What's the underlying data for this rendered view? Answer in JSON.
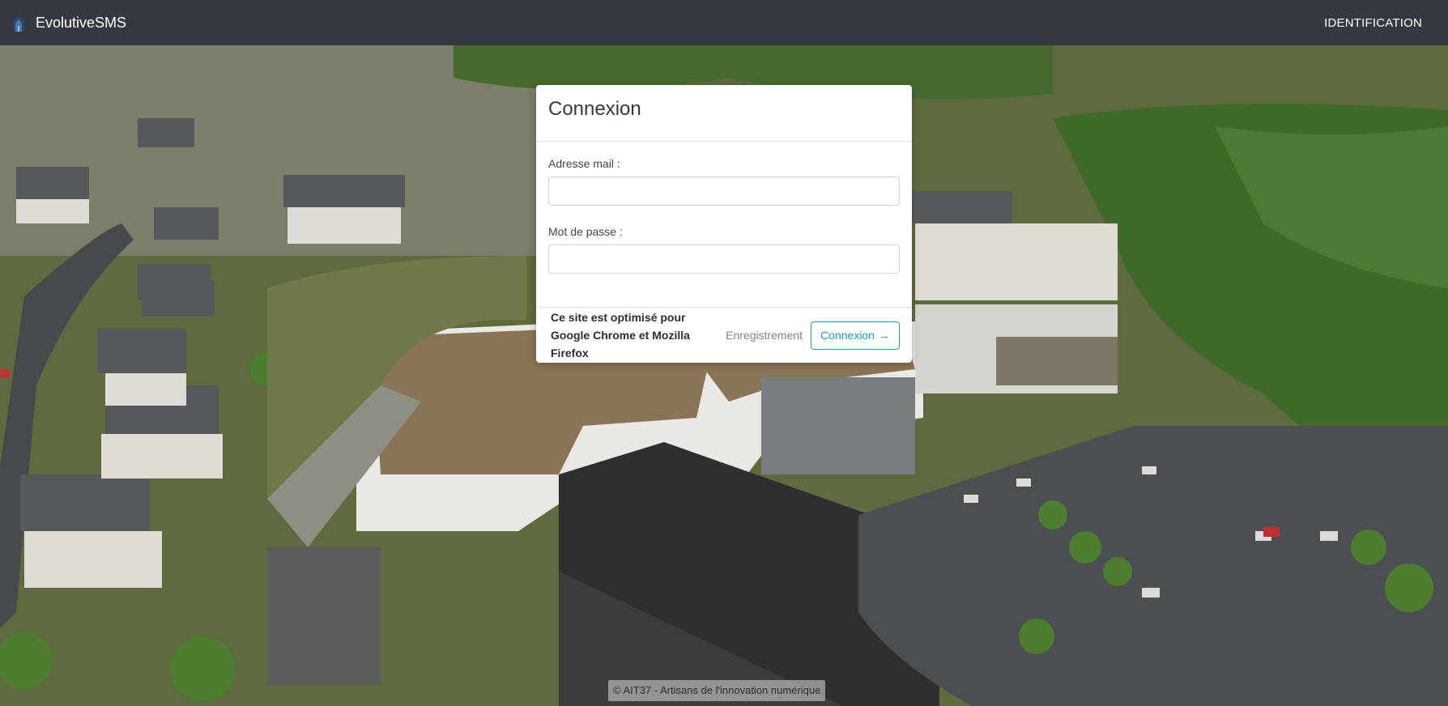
{
  "navbar": {
    "brand": "EvolutiveSMS",
    "brand_icon": "building-logo-icon",
    "link": "IDENTIFICATION"
  },
  "login": {
    "title": "Connexion",
    "email_label": "Adresse mail :",
    "email_value": "",
    "password_label": "Mot de passe :",
    "password_value": "",
    "browser_note": "Ce site est optimisé pour Google Chrome et Mozilla Firefox",
    "register_link": "Enregistrement",
    "submit_label": "Connexion",
    "submit_icon": "arrow-right-icon"
  },
  "footer": {
    "copyright": "© AIT37 - Artisans de l'innovation numérique"
  },
  "colors": {
    "navbar_bg": "#343a40",
    "accent": "#17a2b8",
    "card_bg": "#ffffff"
  }
}
